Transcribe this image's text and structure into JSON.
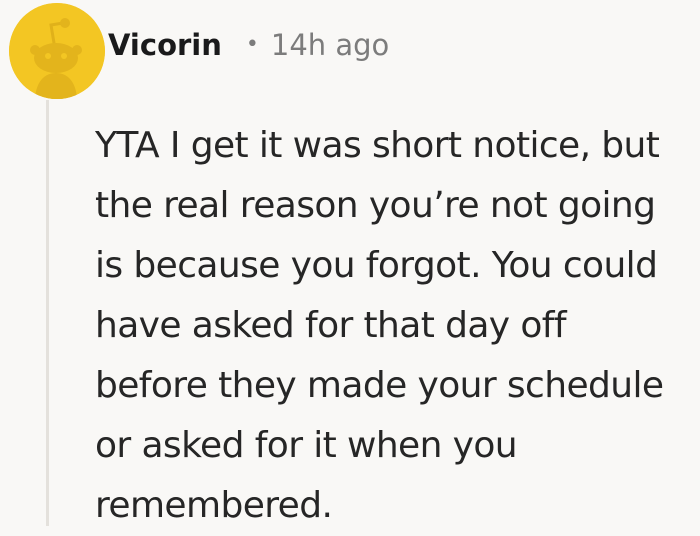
{
  "comment": {
    "username": "Vicorin",
    "separator": "•",
    "timestamp": "14h ago",
    "avatar_icon": "reddit-snoo-icon",
    "avatar_color": "#f3c623",
    "text_lines": [
      "YTA I get it was short notice, but",
      "the real reason you’re not going",
      "is because you forgot. You could",
      "have asked for that day off",
      "before they made your schedule",
      "or asked for it when you",
      "remembered."
    ]
  }
}
